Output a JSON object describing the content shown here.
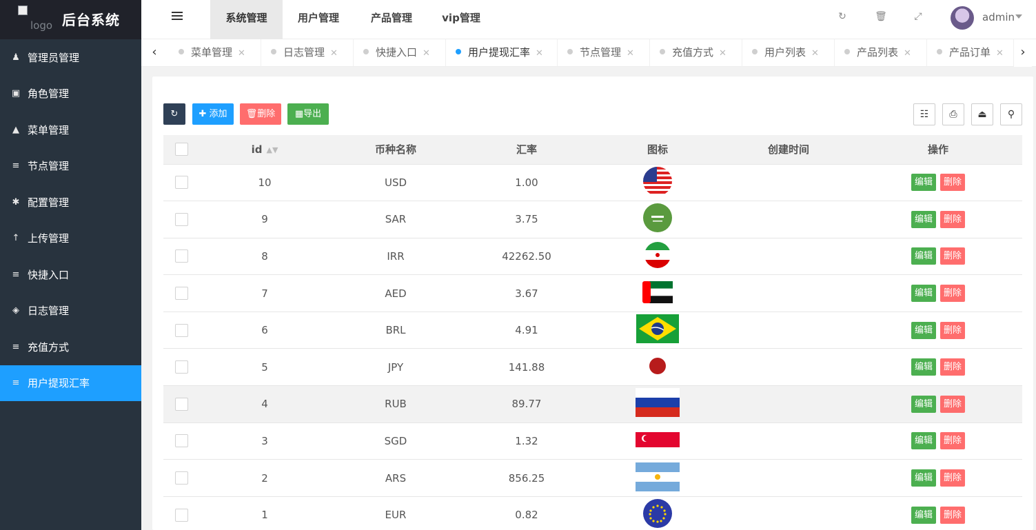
{
  "sidebar": {
    "logo_alt": "logo",
    "title": "后台系统",
    "items": [
      {
        "label": "管理员管理",
        "icon": "user-icon"
      },
      {
        "label": "角色管理",
        "icon": "role-icon"
      },
      {
        "label": "菜单管理",
        "icon": "tree-icon"
      },
      {
        "label": "节点管理",
        "icon": "list-icon"
      },
      {
        "label": "配置管理",
        "icon": "asterisk-icon"
      },
      {
        "label": "上传管理",
        "icon": "upload-arrow-icon"
      },
      {
        "label": "快捷入口",
        "icon": "list-icon"
      },
      {
        "label": "日志管理",
        "icon": "log-icon"
      },
      {
        "label": "充值方式",
        "icon": "list-icon"
      },
      {
        "label": "用户提现汇率",
        "icon": "list-icon"
      }
    ],
    "active_index": 9
  },
  "header": {
    "tabs": [
      {
        "label": "系统管理"
      },
      {
        "label": "用户管理"
      },
      {
        "label": "产品管理"
      },
      {
        "label": "vip管理"
      }
    ],
    "active_tab": 0,
    "user": "admin"
  },
  "page_tabs": {
    "items": [
      {
        "label": "菜单管理"
      },
      {
        "label": "日志管理"
      },
      {
        "label": "快捷入口"
      },
      {
        "label": "用户提现汇率"
      },
      {
        "label": "节点管理"
      },
      {
        "label": "充值方式"
      },
      {
        "label": "用户列表"
      },
      {
        "label": "产品列表"
      },
      {
        "label": "产品订单"
      }
    ],
    "active_index": 3
  },
  "toolbar": {
    "add_label": "添加",
    "delete_label": "删除",
    "export_label": "导出"
  },
  "table": {
    "columns": [
      "id",
      "币种名称",
      "汇率",
      "图标",
      "创建时间",
      "操作"
    ],
    "edit_label": "编辑",
    "delete_label": "删除",
    "rows": [
      {
        "id": "10",
        "name": "USD",
        "rate": "1.00",
        "flag": "us-flag-icon",
        "created": ""
      },
      {
        "id": "9",
        "name": "SAR",
        "rate": "3.75",
        "flag": "saudi-flag-icon",
        "created": ""
      },
      {
        "id": "8",
        "name": "IRR",
        "rate": "42262.50",
        "flag": "iran-flag-icon",
        "created": ""
      },
      {
        "id": "7",
        "name": "AED",
        "rate": "3.67",
        "flag": "uae-flag-icon",
        "created": ""
      },
      {
        "id": "6",
        "name": "BRL",
        "rate": "4.91",
        "flag": "brazil-flag-icon",
        "created": ""
      },
      {
        "id": "5",
        "name": "JPY",
        "rate": "141.88",
        "flag": "japan-flag-icon",
        "created": ""
      },
      {
        "id": "4",
        "name": "RUB",
        "rate": "89.77",
        "flag": "russia-flag-icon",
        "created": ""
      },
      {
        "id": "3",
        "name": "SGD",
        "rate": "1.32",
        "flag": "singapore-flag-icon",
        "created": ""
      },
      {
        "id": "2",
        "name": "ARS",
        "rate": "856.25",
        "flag": "argentina-flag-icon",
        "created": ""
      },
      {
        "id": "1",
        "name": "EUR",
        "rate": "0.82",
        "flag": "eu-flag-icon",
        "created": ""
      }
    ],
    "highlighted_row_index": 6
  }
}
